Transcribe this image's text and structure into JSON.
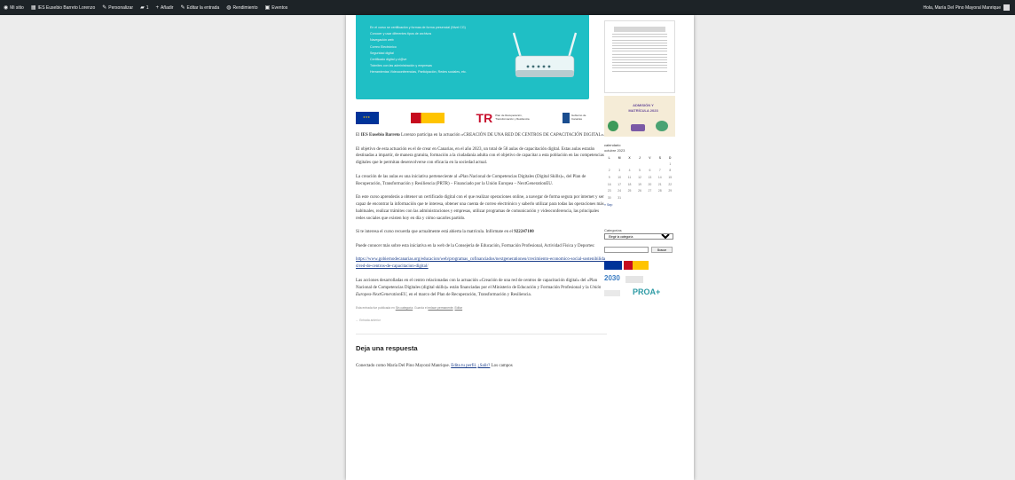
{
  "admin_bar": {
    "items": [
      {
        "icon": "wordpress-icon",
        "glyph": "◉",
        "label": "Mi sitio"
      },
      {
        "icon": "dashboard-icon",
        "glyph": "▦",
        "label": "IES Eusebio Barreto Lorenzo"
      },
      {
        "icon": "customize-icon",
        "glyph": "✎",
        "label": "Personalizar"
      },
      {
        "icon": "comments-icon",
        "glyph": "▰",
        "label": "1"
      },
      {
        "icon": "plus-icon",
        "glyph": "+",
        "label": "Añadir"
      },
      {
        "icon": "edit-icon",
        "glyph": "✎",
        "label": "Editar la entrada"
      },
      {
        "icon": "performance-icon",
        "glyph": "◍",
        "label": "Rendimiento"
      },
      {
        "icon": "calendar-icon",
        "glyph": "▣",
        "label": "Eventos"
      }
    ],
    "greeting": "Hola, María Del Pino Mayoral Manrique"
  },
  "banner": {
    "items": [
      "En el curso se certificación y formas de forma presencial (Nivel CG)",
      "Conocer y usar diferentes tipos de archivos",
      "Navegación web",
      "Correo Electrónico",
      "Seguridad digital",
      "Certificado digital y cl@ve",
      "Trámites con las administración y empresas",
      "Herramientas Videoconferencias, Participación, Redes sociales, etc."
    ]
  },
  "logos": {
    "eu": "Financiado por la Unión Europea NextGenerationEU",
    "prtr": "Plan de Recuperación, Transformación y Resiliencia",
    "canarias": "Gobierno de Canarias"
  },
  "article": {
    "p1_strong": "IES Eusebio Barreto",
    "p1_rest": "Lorenzo participa en la actuación «CREACIÓN DE UNA RED DE CENTROS DE CAPACITACIÓN DIGITAL».",
    "p1_prefix": "El",
    "p2": "El objetivo de esta actuación es el de crear en Canarias, en el año 2023, un total de 58 aulas de capacitación digital. Estas aulas estarán destinadas a impartir, de manera gratuita, formación a la ciudadanía adulta con el objetivo de capacitar a esta población en las competencias digitales que le permitan desenvolverse con eficacia en la sociedad actual.",
    "p3": "La creación de las aulas es una iniciativa perteneciente al «Plan Nacional de Competencias Digitales (Digital Skills)», del Plan de Recuperación, Transformación y Resiliencia (PRTR) – Financiado por la Unión Europea – NextGenerationEU.",
    "p4": "En este curso aprenderás a obtener un certificado digital con el que realizar operaciones online, a navegar de forma segura por internet y ser capaz de encontrar la información que te interesa, obtener una cuenta de correo electrónico y saberlo utilizar para todas las operaciones más habituales, realizar trámites con las administraciones y empresas, utilizar programas de comunicación y videoconferencia, las principales redes sociales que existen hoy en día y cómo sacarles partido.",
    "p5_text": "Si te interesa el curso recuerda que actualmente está abierta la matrícula. Infórmate en el",
    "p5_phone": "922247100",
    "p6": "Puede conocer más sobre esta iniciativa en la web de la Consejería de Educación, Formación Profesional, Actividad Física y Deportes:",
    "link": "https://www.gobiernodecanarias.org/educacion/web/programas_cofinanciados/nextgenerationeu/crecimiento-economico-social-sostenibilidad/red-de-centros-de-capacitacion-digital/",
    "p7_a": "Las acciones desarrolladas en el centro relacionadas con la actuación «Creación de una red de centros de capacitación digital» del «Plan Nacional de Competencias Digitales (digital skills)» están financiadas por el Ministerio de Educación y Formación Profesional y la",
    "p7_em": "Unión Europea-NextGenerationEU,",
    "p7_b": "en el marco del Plan de Recuperación, Transformación y Resiliencia.",
    "meta_a": "Esta entrada fue publicada en",
    "meta_cat": "Sin categoría",
    "meta_b": ". Guarda el",
    "meta_perma": "enlace permanente",
    "meta_c": ".",
    "meta_edit": "Editar",
    "nav_prev": "← Entrada anterior",
    "reply_title": "Deja una respuesta",
    "logged_a": "Conectado como María Del Pino Mayoral Manrique.",
    "logged_edit": "Edita tu perfil.",
    "logged_logout": "¿Salir?",
    "logged_b": "Los campos"
  },
  "sidebar": {
    "admission": "ADMISIÓN Y MATRÍCULA 2023",
    "calendar_title": "calendario",
    "calendar_caption": "octubre 2023",
    "weekdays": [
      "L",
      "M",
      "X",
      "J",
      "V",
      "S",
      "D"
    ],
    "weeks": [
      [
        "",
        "",
        "",
        "",
        "",
        "",
        "1"
      ],
      [
        "2",
        "3",
        "4",
        "5",
        "6",
        "7",
        "8"
      ],
      [
        "9",
        "10",
        "11",
        "12",
        "13",
        "14",
        "15"
      ],
      [
        "16",
        "17",
        "18",
        "19",
        "20",
        "21",
        "22"
      ],
      [
        "23",
        "24",
        "25",
        "26",
        "27",
        "28",
        "29"
      ],
      [
        "30",
        "31",
        "",
        "",
        "",
        "",
        ""
      ]
    ],
    "prev_month": "« Sep",
    "categories_title": "Categorías",
    "categories_selected": "Elegir la categoría",
    "search_button": "Buscar",
    "y2030": "2030",
    "proa": "PROA+"
  }
}
